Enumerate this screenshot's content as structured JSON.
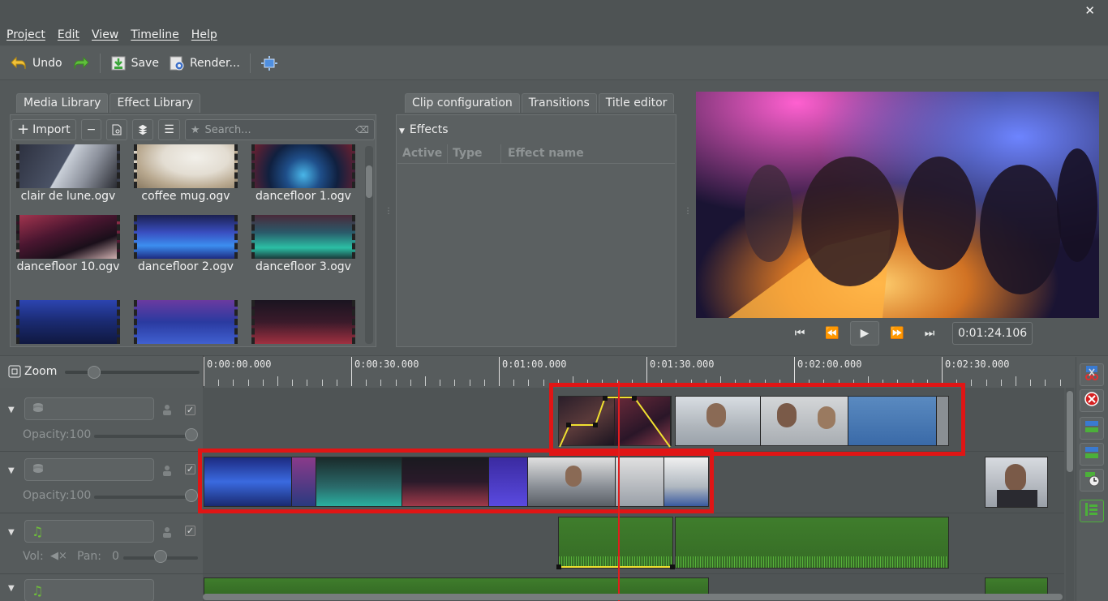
{
  "menu": [
    "Project",
    "Edit",
    "View",
    "Timeline",
    "Help"
  ],
  "toolbar": {
    "undo": "Undo",
    "save": "Save",
    "render": "Render..."
  },
  "library": {
    "tabs": [
      "Media Library",
      "Effect Library"
    ],
    "import": "Import",
    "search_placeholder": "Search...",
    "clips": [
      {
        "name": "clair de lune.ogv"
      },
      {
        "name": "coffee mug.ogv"
      },
      {
        "name": "dancefloor 1.ogv"
      },
      {
        "name": "dancefloor 10.ogv"
      },
      {
        "name": "dancefloor 2.ogv"
      },
      {
        "name": "dancefloor 3.ogv"
      },
      {
        "name": ""
      },
      {
        "name": ""
      },
      {
        "name": ""
      }
    ]
  },
  "config": {
    "tabs": [
      "Clip configuration",
      "Transitions",
      "Title editor"
    ],
    "effects_label": "Effects",
    "columns": [
      "Active",
      "Type",
      "Effect name"
    ]
  },
  "player": {
    "timecode": "0:01:24.106"
  },
  "timeline": {
    "zoom_label": "Zoom",
    "ruler": [
      "0:00:00.000",
      "0:00:30.000",
      "0:01:00.000",
      "0:01:30.000",
      "0:02:00.000",
      "0:02:30.000"
    ],
    "tracks": [
      {
        "type": "video",
        "opacity_label": "Opacity:100"
      },
      {
        "type": "video",
        "opacity_label": "Opacity:100"
      },
      {
        "type": "audio",
        "vol_label": "Vol:",
        "pan_label": "Pan:",
        "pan_value": "0"
      },
      {
        "type": "audio"
      }
    ]
  },
  "colors": {
    "highlight": "#e01515",
    "playhead": "#e11d1d",
    "audio_clip": "#3f7d2c"
  }
}
